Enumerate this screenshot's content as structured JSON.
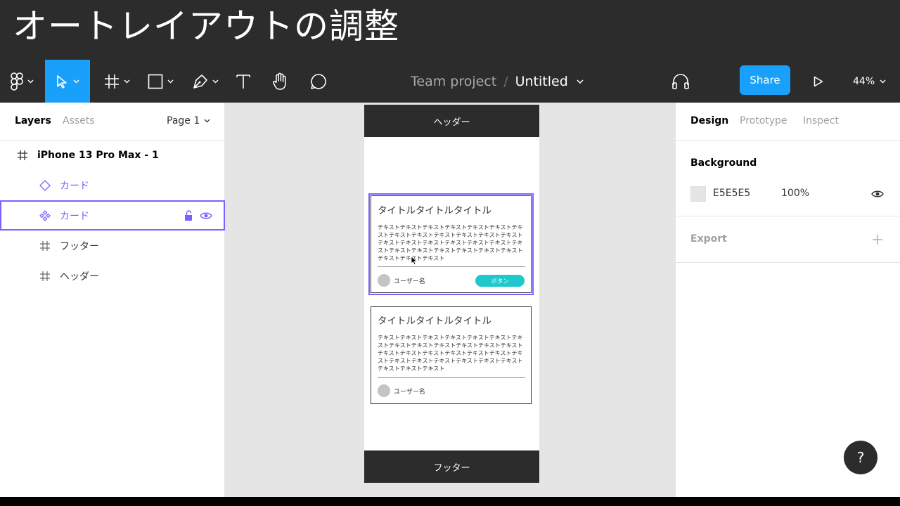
{
  "banner": {
    "title": "オートレイアウトの調整"
  },
  "toolbar": {
    "breadcrumb_team": "Team project",
    "breadcrumb_sep": "/",
    "breadcrumb_file": "Untitled",
    "share_label": "Share",
    "zoom_label": "44%",
    "tools": [
      "figma-menu-icon",
      "move-tool-icon",
      "frame-tool-icon",
      "rectangle-tool-icon",
      "pen-tool-icon",
      "text-tool-icon",
      "hand-tool-icon",
      "comment-tool-icon"
    ],
    "active_tool": "move-tool-icon",
    "accent": "#18A0FB"
  },
  "left_panel": {
    "tabs": [
      "Layers",
      "Assets"
    ],
    "active_tab": "Layers",
    "page_label": "Page 1",
    "layers": [
      {
        "name": "iPhone 13 Pro Max - 1",
        "icon": "frame-icon"
      },
      {
        "name": "カード",
        "icon": "instance-icon"
      },
      {
        "name": "カード",
        "icon": "component-icon",
        "selected": true
      },
      {
        "name": "フッター",
        "icon": "frame-icon"
      },
      {
        "name": "ヘッダー",
        "icon": "frame-icon"
      }
    ]
  },
  "canvas": {
    "header_label": "ヘッダー",
    "footer_label": "フッター",
    "cards": [
      {
        "title": "タイトルタイトルタイトル",
        "body": "テキストテキストテキストテキストテキストテキストテキストテキストテキストテキストテキストテキストテキストテキストテキストテキストテキストテキストテキストテキストテキストテキストテキストテキストテキストテキストテキストテキストテキスト",
        "user": "ユーザー名",
        "button": "ボタン",
        "selected": true
      },
      {
        "title": "タイトルタイトルタイトル",
        "body": "テキストテキストテキストテキストテキストテキストテキストテキストテキストテキストテキストテキストテキストテキストテキストテキストテキストテキストテキストテキストテキストテキストテキストテキストテキストテキストテキストテキストテキスト",
        "user": "ユーザー名"
      }
    ],
    "background": "#E5E5E5",
    "selection_color": "#7B61FF",
    "button_color": "#1EC8CC"
  },
  "right_panel": {
    "tabs": [
      "Design",
      "Prototype",
      "Inspect"
    ],
    "active_tab": "Design",
    "background_title": "Background",
    "background_hex": "E5E5E5",
    "background_opacity": "100%",
    "export_title": "Export"
  },
  "help_label": "?"
}
